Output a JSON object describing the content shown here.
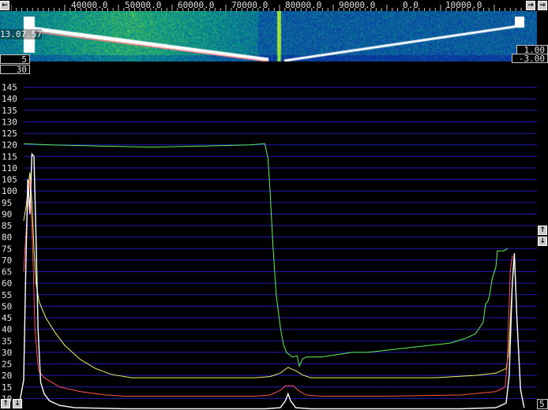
{
  "freq_axis": {
    "labels": [
      "40000.0",
      "50000.0",
      "60000.0",
      "70000.0",
      "80000.0",
      "90000.0",
      "0.0",
      "10000.0"
    ]
  },
  "waterfall": {
    "timestamp": "13.07.57"
  },
  "controls": {
    "avg_count": "5",
    "averaging": "30",
    "gain": "1.00",
    "zero": "-3.00",
    "right_bottom": "5",
    "left_arrow": "←",
    "right_arrow": "→",
    "up_arrow": "↑",
    "down_arrow": "↓"
  },
  "colors": {
    "grid": "#1c1cb4",
    "green": "#5cf05c",
    "yellow": "#f0f060",
    "red": "#ff5050",
    "white": "#ffffff"
  },
  "chart_data": {
    "type": "line",
    "yticks": [
      10,
      15,
      20,
      25,
      30,
      35,
      40,
      45,
      50,
      55,
      60,
      65,
      70,
      75,
      80,
      85,
      90,
      95,
      100,
      105,
      110,
      115,
      120,
      125,
      130,
      135,
      140,
      145
    ],
    "ylim": [
      5,
      150
    ],
    "xlim": [
      0,
      100
    ],
    "series": [
      {
        "color": "green",
        "points": [
          [
            0,
            120.5
          ],
          [
            5,
            120
          ],
          [
            15,
            119.5
          ],
          [
            25,
            119
          ],
          [
            35,
            119.5
          ],
          [
            44,
            120
          ],
          [
            47,
            120.5
          ],
          [
            47.6,
            114
          ],
          [
            48,
            100
          ],
          [
            48.6,
            75
          ],
          [
            49.2,
            55
          ],
          [
            50,
            41
          ],
          [
            50.6,
            33.5
          ],
          [
            51.2,
            30
          ],
          [
            52.3,
            28
          ],
          [
            53.3,
            28.5
          ],
          [
            53.7,
            24
          ],
          [
            54.3,
            27
          ],
          [
            55,
            28
          ],
          [
            56,
            28
          ],
          [
            58,
            28
          ],
          [
            61,
            29
          ],
          [
            64,
            30
          ],
          [
            67,
            30
          ],
          [
            71,
            31
          ],
          [
            75,
            32
          ],
          [
            79,
            33
          ],
          [
            83,
            34
          ],
          [
            86,
            36
          ],
          [
            88,
            38
          ],
          [
            89.5,
            43
          ],
          [
            90,
            51
          ],
          [
            90.4,
            52
          ],
          [
            90.7,
            54
          ],
          [
            91.3,
            62
          ],
          [
            92,
            67
          ],
          [
            92.3,
            74
          ],
          [
            93.5,
            74
          ],
          [
            94.3,
            75
          ]
        ]
      },
      {
        "color": "yellow",
        "points": [
          [
            0,
            87
          ],
          [
            0.5,
            94
          ],
          [
            1.2,
            108
          ],
          [
            1.6,
            95
          ],
          [
            2.0,
            75
          ],
          [
            2.4,
            60
          ],
          [
            3.0,
            52
          ],
          [
            4.3,
            45
          ],
          [
            6,
            39
          ],
          [
            8,
            33
          ],
          [
            11,
            27
          ],
          [
            14,
            23
          ],
          [
            17,
            20.5
          ],
          [
            21,
            19
          ],
          [
            25,
            19
          ],
          [
            35,
            19
          ],
          [
            45,
            19
          ],
          [
            48,
            19.5
          ],
          [
            50,
            21
          ],
          [
            51.5,
            23.5
          ],
          [
            53,
            22
          ],
          [
            54.5,
            20
          ],
          [
            56,
            19
          ],
          [
            60,
            19
          ],
          [
            70,
            19
          ],
          [
            80,
            19
          ],
          [
            88,
            20
          ],
          [
            92,
            21
          ],
          [
            94,
            23
          ],
          [
            94.5,
            30
          ],
          [
            94.9,
            48
          ],
          [
            95.2,
            60
          ],
          [
            95.5,
            68
          ]
        ]
      },
      {
        "color": "red",
        "points": [
          [
            0,
            65
          ],
          [
            0.5,
            84
          ],
          [
            1.2,
            105
          ],
          [
            1.7,
            80
          ],
          [
            2.2,
            40
          ],
          [
            2.9,
            22
          ],
          [
            4,
            19
          ],
          [
            7,
            15
          ],
          [
            11,
            13
          ],
          [
            16,
            11.5
          ],
          [
            20,
            11
          ],
          [
            30,
            11
          ],
          [
            45,
            11
          ],
          [
            48,
            11.5
          ],
          [
            50,
            13.5
          ],
          [
            51,
            15.5
          ],
          [
            52.5,
            15.5
          ],
          [
            53.5,
            13.5
          ],
          [
            55,
            11.5
          ],
          [
            58,
            11
          ],
          [
            70,
            11
          ],
          [
            85,
            11.5
          ],
          [
            92,
            13
          ],
          [
            93.8,
            15
          ],
          [
            94.2,
            25
          ],
          [
            94.5,
            45
          ],
          [
            94.8,
            65
          ],
          [
            95.2,
            72
          ]
        ]
      },
      {
        "color": "white",
        "points": [
          [
            -1,
            6
          ],
          [
            -0.5,
            12
          ],
          [
            0,
            18
          ],
          [
            0.4,
            65
          ],
          [
            0.8,
            105
          ],
          [
            1.2,
            90
          ],
          [
            1.6,
            116
          ],
          [
            2.0,
            115
          ],
          [
            2.4,
            80
          ],
          [
            2.8,
            40
          ],
          [
            3.3,
            17
          ],
          [
            4,
            12
          ],
          [
            5,
            9
          ],
          [
            7,
            7
          ],
          [
            10,
            6
          ],
          [
            20,
            5.5
          ],
          [
            30,
            5.5
          ],
          [
            40,
            5.5
          ],
          [
            47,
            5.5
          ],
          [
            50,
            6
          ],
          [
            51,
            9
          ],
          [
            51.5,
            12
          ],
          [
            52,
            9
          ],
          [
            53,
            6
          ],
          [
            56,
            5.5
          ],
          [
            70,
            5.5
          ],
          [
            85,
            5.5
          ],
          [
            92,
            6
          ],
          [
            94,
            8
          ],
          [
            94.6,
            20
          ],
          [
            95.2,
            60
          ],
          [
            95.6,
            73
          ],
          [
            96.1,
            45
          ],
          [
            96.8,
            14
          ],
          [
            97.5,
            6
          ]
        ]
      }
    ]
  }
}
